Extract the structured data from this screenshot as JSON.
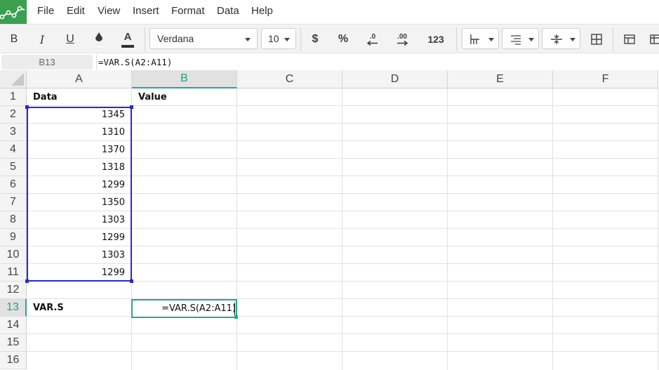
{
  "menu": {
    "items": [
      "File",
      "Edit",
      "View",
      "Insert",
      "Format",
      "Data",
      "Help"
    ]
  },
  "toolbar": {
    "bold": "B",
    "italic": "I",
    "underline": "U",
    "font_color": "A",
    "font_name": "Verdana",
    "font_size": "10",
    "currency": "$",
    "percent": "%",
    "decrease_decimals": ".0",
    "increase_decimals": ".00",
    "number_format": "123"
  },
  "formula_bar": {
    "cell_ref": "B13",
    "formula": "=VAR.S(A2:A11)"
  },
  "grid": {
    "columns": [
      "A",
      "B",
      "C",
      "D",
      "E",
      "F"
    ],
    "rows": [
      "1",
      "2",
      "3",
      "4",
      "5",
      "6",
      "7",
      "8",
      "9",
      "10",
      "11",
      "12",
      "13",
      "14",
      "15",
      "16"
    ],
    "active_column": "B",
    "active_row": "13",
    "header_a1": "Data",
    "header_b1": "Value",
    "data_values": [
      "1345",
      "1310",
      "1370",
      "1318",
      "1299",
      "1350",
      "1303",
      "1299",
      "1303",
      "1299"
    ],
    "label_a13": "VAR.S",
    "editing_text": "=VAR.S(A2:A11)"
  },
  "colors": {
    "accent": "#27a88f",
    "range_highlight": "#2929c9",
    "logo_bg": "#3a9f4e"
  }
}
